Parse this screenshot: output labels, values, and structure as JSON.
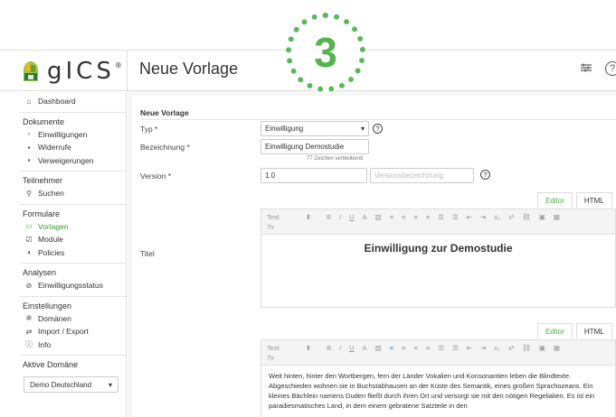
{
  "step_badge": "3",
  "header": {
    "logo_text": "gICS",
    "logo_reg": "®",
    "page_title": "Neue Vorlage",
    "settings_icon": "sliders-icon",
    "help_icon": "help-icon",
    "help_glyph": "?"
  },
  "sidebar": {
    "dashboard": "Dashboard",
    "dokumente": {
      "heading": "Dokumente",
      "items": [
        "Einwilligungen",
        "Widerrufe",
        "Verweigerungen"
      ]
    },
    "teilnehmer": {
      "heading": "Teilnehmer",
      "items": [
        "Suchen"
      ]
    },
    "formulare": {
      "heading": "Formulare",
      "items": [
        "Vorlagen",
        "Module",
        "Policies"
      ]
    },
    "analysen": {
      "heading": "Analysen",
      "items": [
        "Einwilligungsstatus"
      ]
    },
    "einstellungen": {
      "heading": "Einstellungen",
      "items": [
        "Domänen",
        "Import / Export",
        "Info"
      ]
    },
    "aktive_domaene": {
      "heading": "Aktive Domäne",
      "value": "Demo Deutschland"
    }
  },
  "form": {
    "section_title": "Neue Vorlage",
    "typ_label": "Typ *",
    "typ_value": "Einwilligung",
    "bezeichnung_label": "Bezeichnung *",
    "bezeichnung_value": "Einwilligung Demostudie",
    "bezeichnung_hint": "77 Zeichen verbleibend",
    "version_label": "Version *",
    "version_value": "1.0",
    "versionsbezeichnung_placeholder": "Versionsbezeichnung",
    "titel_label": "Titel",
    "tab_editor": "Editor",
    "tab_html": "HTML",
    "toolbar_format": "Text",
    "toolbar_clear": "Tx",
    "titel_content": "Einwilligung zur Demostudie",
    "body_content": "Weit hinten, hinter den Wortbergen, fern der Länder Vokalien und Konsonantien leben die Blindtexte. Abgeschieden wohnen sie in Buchstabhausen an der Küste des Semantik, eines großen Sprachozeans. Ein kleines Bächlein namens Duden fließt durch ihren Ort und versorgt sie mit den nötigen Regelialien. Es ist ein paradiesmatisches Land, in dem einem gebratene Satzteile in den"
  }
}
